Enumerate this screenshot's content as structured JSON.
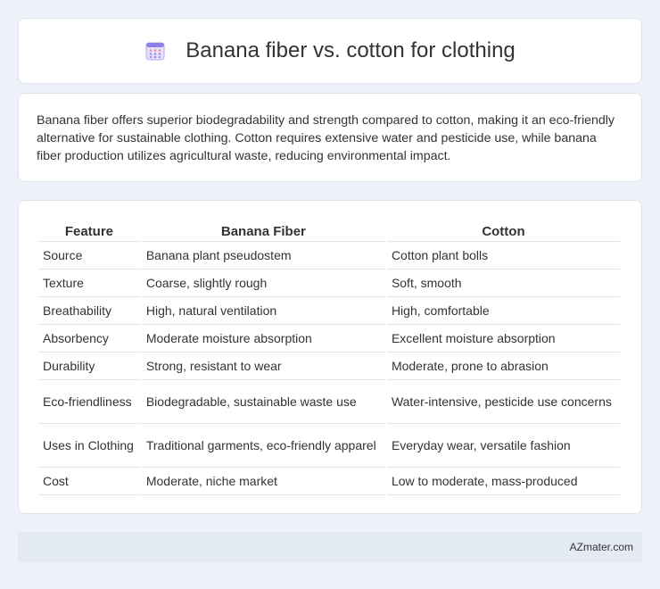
{
  "header": {
    "title": "Banana fiber vs. cotton for clothing",
    "icon": "calendar-grid-icon",
    "icon_color": "#8f7fe8"
  },
  "summary": {
    "text": "Banana fiber offers superior biodegradability and strength compared to cotton, making it an eco-friendly alternative for sustainable clothing. Cotton requires extensive water and pesticide use, while banana fiber production utilizes agricultural waste, reducing environmental impact."
  },
  "table": {
    "headers": [
      "Feature",
      "Banana Fiber",
      "Cotton"
    ],
    "rows": [
      [
        "Source",
        "Banana plant pseudostem",
        "Cotton plant bolls"
      ],
      [
        "Texture",
        "Coarse, slightly rough",
        "Soft, smooth"
      ],
      [
        "Breathability",
        "High, natural ventilation",
        "High, comfortable"
      ],
      [
        "Absorbency",
        "Moderate moisture absorption",
        "Excellent moisture absorption"
      ],
      [
        "Durability",
        "Strong, resistant to wear",
        "Moderate, prone to abrasion"
      ],
      [
        "Eco-friendliness",
        "Biodegradable, sustainable waste use",
        "Water-intensive, pesticide use concerns"
      ],
      [
        "Uses in Clothing",
        "Traditional garments, eco-friendly apparel",
        "Everyday wear, versatile fashion"
      ],
      [
        "Cost",
        "Moderate, niche market",
        "Low to moderate, mass-produced"
      ]
    ]
  },
  "footer": {
    "brand": "AZmater.com"
  }
}
